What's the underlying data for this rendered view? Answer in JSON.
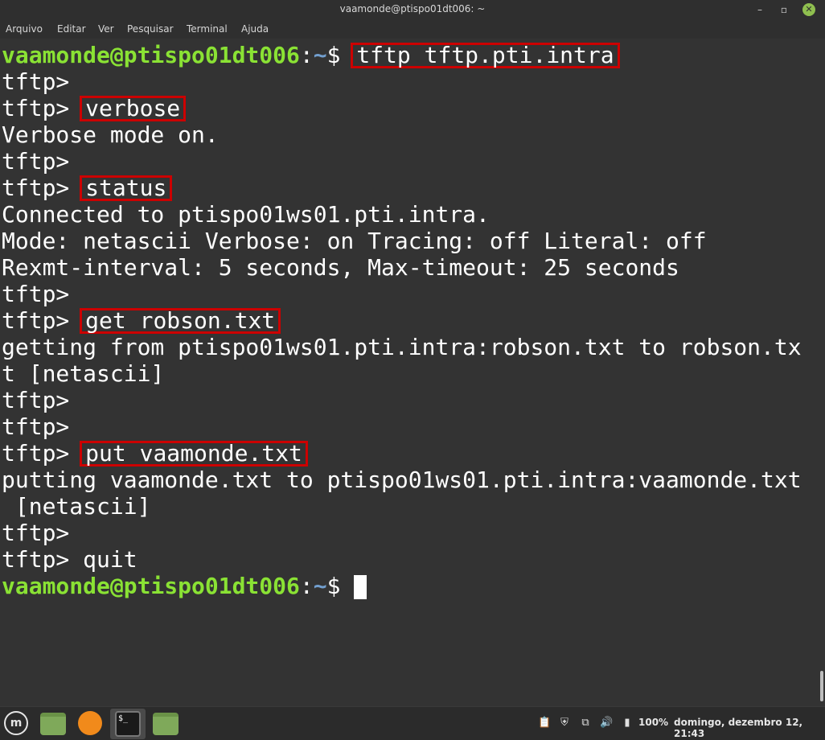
{
  "window": {
    "title": "vaamonde@ptispo01dt006: ~",
    "buttons": {
      "minimize": "–",
      "maximize": "▫",
      "close": "✕"
    }
  },
  "menubar": {
    "items": [
      "Arquivo",
      "Editar",
      "Ver",
      "Pesquisar",
      "Terminal",
      "Ajuda"
    ]
  },
  "terminal": {
    "prompt_user": "vaamonde@ptispo01dt006",
    "prompt_sep": ":",
    "prompt_path": "~",
    "prompt_dollar": "$ ",
    "cmd1": "tftp tftp.pti.intra",
    "tftp_prompt": "tftp> ",
    "tftp_prompt_bare": "tftp>",
    "cmd_verbose": "verbose",
    "out_verbose": "Verbose mode on.",
    "cmd_status": "status",
    "out_status1": "Connected to ptispo01ws01.pti.intra.",
    "out_status2": "Mode: netascii Verbose: on Tracing: off Literal: off",
    "out_status3": "Rexmt-interval: 5 seconds, Max-timeout: 25 seconds",
    "cmd_get": "get robson.txt",
    "out_get1": "getting from ptispo01ws01.pti.intra:robson.txt to robson.tx",
    "out_get2": "t [netascii]",
    "cmd_put": "put vaamonde.txt",
    "out_put1": "putting vaamonde.txt to ptispo01ws01.pti.intra:vaamonde.txt",
    "out_put2": " [netascii]",
    "cmd_quit": "quit"
  },
  "taskbar": {
    "terminal_icon_text": "$_",
    "battery": "100%",
    "clock": "domingo, dezembro 12, 21:43"
  },
  "icons": {
    "menu": "linux-mint-menu-icon",
    "files": "folder-icon",
    "browser": "firefox-icon",
    "terminal": "terminal-icon",
    "home": "folder-icon"
  },
  "colors": {
    "prompt_user": "#8ae234",
    "prompt_path": "#729fcf",
    "highlight_box": "#cc0000",
    "terminal_bg": "#333333"
  }
}
